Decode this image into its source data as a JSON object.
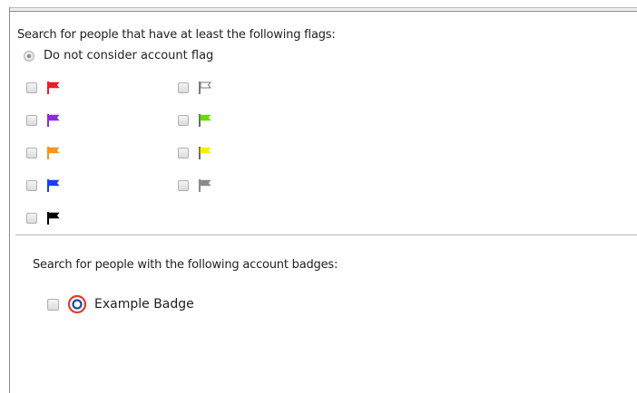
{
  "flags_section": {
    "title": "Search for people that have at least the following flags:",
    "radio_label": "Do not consider account flag",
    "flags": [
      {
        "name": "red",
        "color": "#ee1c24",
        "filled": true
      },
      {
        "name": "purple",
        "color": "#8b2be8",
        "filled": true
      },
      {
        "name": "orange",
        "color": "#f7941d",
        "filled": true
      },
      {
        "name": "blue",
        "color": "#1d3cf2",
        "filled": true
      },
      {
        "name": "black",
        "color": "#000000",
        "filled": true
      },
      {
        "name": "white",
        "color": "#ffffff",
        "filled": false
      },
      {
        "name": "green",
        "color": "#66e000",
        "filled": true
      },
      {
        "name": "yellow",
        "color": "#f5f000",
        "filled": true
      },
      {
        "name": "gray",
        "color": "#8a8a8a",
        "filled": true
      }
    ]
  },
  "badges_section": {
    "title": "Search for people with the following account badges:",
    "badges": [
      {
        "label": "Example Badge",
        "ring_color": "#e03c31",
        "center_color": "#1d4e9a"
      }
    ]
  }
}
